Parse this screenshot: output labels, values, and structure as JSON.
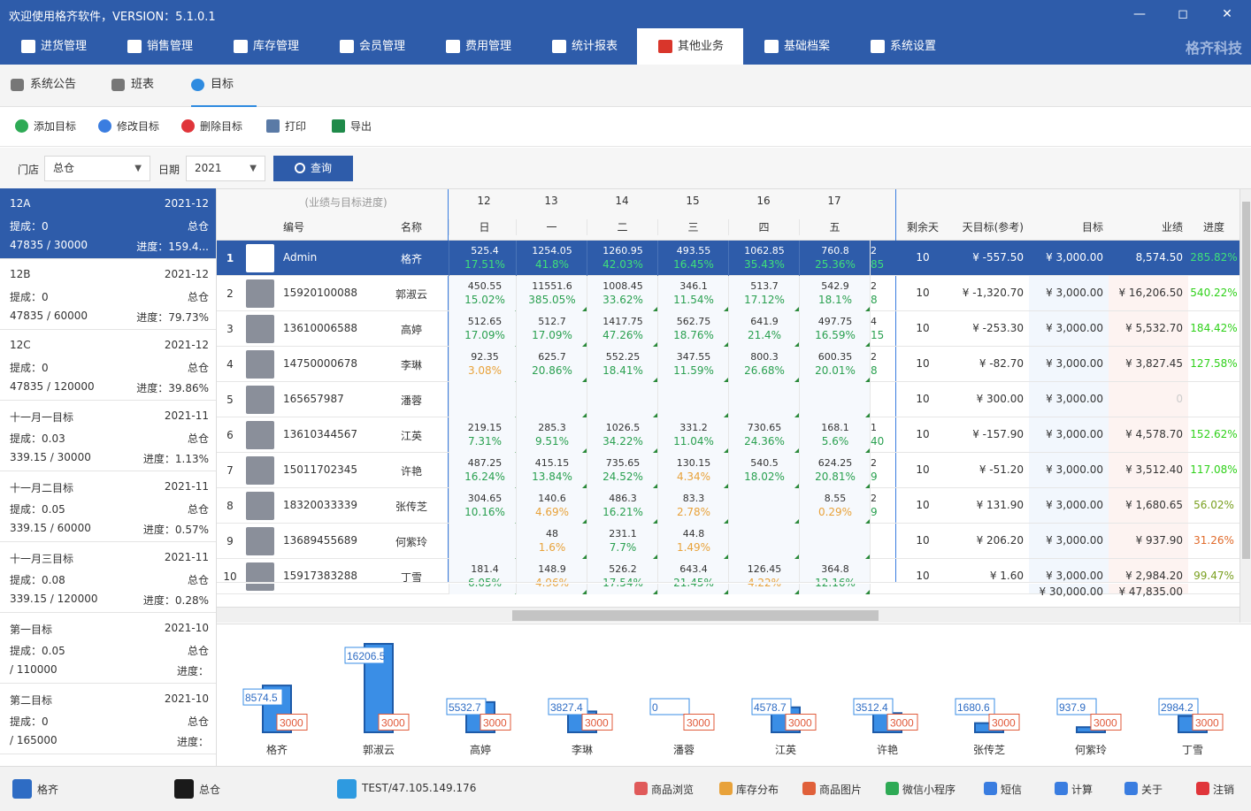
{
  "window": {
    "title": "欢迎使用格齐软件，VERSION：5.1.0.1"
  },
  "nav": {
    "items": [
      {
        "label": "进货管理",
        "icon": "cart-icon"
      },
      {
        "label": "销售管理",
        "icon": "sales-icon"
      },
      {
        "label": "库存管理",
        "icon": "box-icon"
      },
      {
        "label": "会员管理",
        "icon": "crown-icon"
      },
      {
        "label": "费用管理",
        "icon": "wallet-icon"
      },
      {
        "label": "统计报表",
        "icon": "piechart-icon"
      },
      {
        "label": "其他业务",
        "icon": "clover-icon",
        "active": true
      },
      {
        "label": "基础档案",
        "icon": "puzzle-icon"
      },
      {
        "label": "系统设置",
        "icon": "gear-icon"
      }
    ],
    "brand": "格齐科技"
  },
  "subtabs": [
    {
      "label": "系统公告",
      "icon": "megaphone-icon"
    },
    {
      "label": "班表",
      "icon": "calendar-icon"
    },
    {
      "label": "目标",
      "icon": "target-icon",
      "active": true
    }
  ],
  "toolbar": [
    {
      "label": "添加目标",
      "icon": "plus-circle-icon",
      "color": "#2eaa55"
    },
    {
      "label": "修改目标",
      "icon": "edit-icon",
      "color": "#3a7de0"
    },
    {
      "label": "删除目标",
      "icon": "delete-icon",
      "color": "#e0353a"
    },
    {
      "label": "打印",
      "icon": "printer-icon",
      "color": "#5a7aa6"
    },
    {
      "label": "导出",
      "icon": "excel-icon",
      "color": "#1f8a4a"
    }
  ],
  "filter": {
    "store_label": "门店",
    "store_value": "总仓",
    "date_label": "日期",
    "date_value": "2021",
    "query": "查询"
  },
  "targets": [
    {
      "name": "12A",
      "period": "2021-12",
      "bonus": "提成：0",
      "store": "总仓",
      "ratio": "47835 / 30000",
      "progress": "进度：159.4..."
    },
    {
      "name": "12B",
      "period": "2021-12",
      "bonus": "提成：0",
      "store": "总仓",
      "ratio": "47835 / 60000",
      "progress": "进度：79.73%"
    },
    {
      "name": "12C",
      "period": "2021-12",
      "bonus": "提成：0",
      "store": "总仓",
      "ratio": "47835 / 120000",
      "progress": "进度：39.86%"
    },
    {
      "name": "十一月一目标",
      "period": "2021-11",
      "bonus": "提成：0.03",
      "store": "总仓",
      "ratio": "339.15 / 30000",
      "progress": "进度：1.13%"
    },
    {
      "name": "十一月二目标",
      "period": "2021-11",
      "bonus": "提成：0.05",
      "store": "总仓",
      "ratio": "339.15 / 60000",
      "progress": "进度：0.57%"
    },
    {
      "name": "十一月三目标",
      "period": "2021-11",
      "bonus": "提成：0.08",
      "store": "总仓",
      "ratio": "339.15 / 120000",
      "progress": "进度：0.28%"
    },
    {
      "name": "第一目标",
      "period": "2021-10",
      "bonus": "提成：0.05",
      "store": "总仓",
      "ratio": " / 110000",
      "progress": "进度："
    },
    {
      "name": "第二目标",
      "period": "2021-10",
      "bonus": "提成：0",
      "store": "总仓",
      "ratio": " / 165000",
      "progress": "进度："
    }
  ],
  "grid": {
    "group_header": "(业绩与目标进度)",
    "col_id": "编号",
    "col_name": "名称",
    "days": [
      {
        "day": "12",
        "weekday": "日"
      },
      {
        "day": "13",
        "weekday": "一"
      },
      {
        "day": "14",
        "weekday": "二"
      },
      {
        "day": "15",
        "weekday": "三"
      },
      {
        "day": "16",
        "weekday": "四"
      },
      {
        "day": "17",
        "weekday": "五"
      }
    ],
    "col_remaining": "剩余天",
    "col_daily": "天目标(参考)",
    "col_target": "目标",
    "col_sales": "业绩",
    "col_progress": "进度",
    "rows": [
      {
        "no": "1",
        "id": "Admin",
        "name": "格齐",
        "cells": [
          [
            "525.4",
            "17.51%"
          ],
          [
            "1254.05",
            "41.8%"
          ],
          [
            "1260.95",
            "42.03%"
          ],
          [
            "493.55",
            "16.45%"
          ],
          [
            "1062.85",
            "35.43%"
          ],
          [
            "760.8",
            "25.36%"
          ]
        ],
        "edge": [
          "2",
          "85"
        ],
        "remain": "10",
        "daily": "¥ -557.50",
        "target": "¥ 3,000.00",
        "sales": "8,574.50",
        "progress": "285.82%"
      },
      {
        "no": "2",
        "id": "15920100088",
        "name": "郭淑云",
        "cells": [
          [
            "450.55",
            "15.02%"
          ],
          [
            "11551.6",
            "385.05%"
          ],
          [
            "1008.45",
            "33.62%"
          ],
          [
            "346.1",
            "11.54%"
          ],
          [
            "513.7",
            "17.12%"
          ],
          [
            "542.9",
            "18.1%"
          ]
        ],
        "edge": [
          "2",
          "8"
        ],
        "remain": "10",
        "daily": "¥ -1,320.70",
        "target": "¥ 3,000.00",
        "sales": "¥ 16,206.50",
        "progress": "540.22%"
      },
      {
        "no": "3",
        "id": "13610006588",
        "name": "高婷",
        "cells": [
          [
            "512.65",
            "17.09%"
          ],
          [
            "512.7",
            "17.09%"
          ],
          [
            "1417.75",
            "47.26%"
          ],
          [
            "562.75",
            "18.76%"
          ],
          [
            "641.9",
            "21.4%"
          ],
          [
            "497.75",
            "16.59%"
          ]
        ],
        "edge": [
          "4",
          "15"
        ],
        "remain": "10",
        "daily": "¥ -253.30",
        "target": "¥ 3,000.00",
        "sales": "¥ 5,532.70",
        "progress": "184.42%"
      },
      {
        "no": "4",
        "id": "14750000678",
        "name": "李琳",
        "cells": [
          [
            "92.35",
            "3.08%"
          ],
          [
            "625.7",
            "20.86%"
          ],
          [
            "552.25",
            "18.41%"
          ],
          [
            "347.55",
            "11.59%"
          ],
          [
            "800.3",
            "26.68%"
          ],
          [
            "600.35",
            "20.01%"
          ]
        ],
        "edge": [
          "2",
          "8"
        ],
        "remain": "10",
        "daily": "¥ -82.70",
        "target": "¥ 3,000.00",
        "sales": "¥ 3,827.45",
        "progress": "127.58%"
      },
      {
        "no": "5",
        "id": "165657987",
        "name": "潘蓉",
        "cells": [
          [
            "",
            ""
          ],
          [
            "",
            ""
          ],
          [
            "",
            ""
          ],
          [
            "",
            ""
          ],
          [
            "",
            ""
          ],
          [
            "",
            ""
          ]
        ],
        "edge": [
          "",
          ""
        ],
        "remain": "10",
        "daily": "¥ 300.00",
        "target": "¥ 3,000.00",
        "sales": "0",
        "progress": ""
      },
      {
        "no": "6",
        "id": "13610344567",
        "name": "江英",
        "cells": [
          [
            "219.15",
            "7.31%"
          ],
          [
            "285.3",
            "9.51%"
          ],
          [
            "1026.5",
            "34.22%"
          ],
          [
            "331.2",
            "11.04%"
          ],
          [
            "730.65",
            "24.36%"
          ],
          [
            "168.1",
            "5.6%"
          ]
        ],
        "edge": [
          "1",
          "40"
        ],
        "remain": "10",
        "daily": "¥ -157.90",
        "target": "¥ 3,000.00",
        "sales": "¥ 4,578.70",
        "progress": "152.62%"
      },
      {
        "no": "7",
        "id": "15011702345",
        "name": "许艳",
        "cells": [
          [
            "487.25",
            "16.24%"
          ],
          [
            "415.15",
            "13.84%"
          ],
          [
            "735.65",
            "24.52%"
          ],
          [
            "130.15",
            "4.34%"
          ],
          [
            "540.5",
            "18.02%"
          ],
          [
            "624.25",
            "20.81%"
          ]
        ],
        "edge": [
          "2",
          "9"
        ],
        "remain": "10",
        "daily": "¥ -51.20",
        "target": "¥ 3,000.00",
        "sales": "¥ 3,512.40",
        "progress": "117.08%"
      },
      {
        "no": "8",
        "id": "18320033339",
        "name": "张传芝",
        "cells": [
          [
            "304.65",
            "10.16%"
          ],
          [
            "140.6",
            "4.69%"
          ],
          [
            "486.3",
            "16.21%"
          ],
          [
            "83.3",
            "2.78%"
          ],
          [
            "",
            ""
          ],
          [
            "8.55",
            "0.29%"
          ]
        ],
        "edge": [
          "2",
          "9"
        ],
        "remain": "10",
        "daily": "¥ 131.90",
        "target": "¥ 3,000.00",
        "sales": "¥ 1,680.65",
        "progress": "56.02%"
      },
      {
        "no": "9",
        "id": "13689455689",
        "name": "何紫玲",
        "cells": [
          [
            "",
            ""
          ],
          [
            "48",
            "1.6%"
          ],
          [
            "231.1",
            "7.7%"
          ],
          [
            "44.8",
            "1.49%"
          ],
          [
            "",
            ""
          ],
          [
            "",
            ""
          ]
        ],
        "edge": [
          "",
          ""
        ],
        "remain": "10",
        "daily": "¥ 206.20",
        "target": "¥ 3,000.00",
        "sales": "¥ 937.90",
        "progress": "31.26%"
      },
      {
        "no": "10",
        "id": "15917383288",
        "name": "丁雪",
        "cells": [
          [
            "181.4",
            "6.05%"
          ],
          [
            "148.9",
            "4.96%"
          ],
          [
            "526.2",
            "17.54%"
          ],
          [
            "643.4",
            "21.45%"
          ],
          [
            "126.45",
            "4.22%"
          ],
          [
            "364.8",
            "12.16%"
          ]
        ],
        "edge": [
          "",
          ""
        ],
        "remain": "10",
        "daily": "¥ 1.60",
        "target": "¥ 3,000.00",
        "sales": "¥ 2,984.20",
        "progress": "99.47%"
      }
    ],
    "total_target": "¥ 30,000.00",
    "total_sales": "¥ 47,835.00"
  },
  "chart_data": {
    "type": "bar",
    "categories": [
      "格齐",
      "郭淑云",
      "高婷",
      "李琳",
      "潘蓉",
      "江英",
      "许艳",
      "张传芝",
      "何紫玲",
      "丁雪"
    ],
    "series": [
      {
        "values": [
          8574.5,
          16206.5,
          5532.7,
          3827.45,
          0,
          4578.7,
          3512.4,
          1680.65,
          937.9,
          2984.2
        ]
      },
      {
        "values": [
          3000,
          3000,
          3000,
          3000,
          3000,
          3000,
          3000,
          3000,
          3000,
          3000
        ]
      }
    ],
    "value_labels": [
      "8574.5",
      "16206.5",
      "5532.7",
      "3827.4",
      "0",
      "4578.7",
      "3512.4",
      "1680.6",
      "937.9",
      "2984.2"
    ],
    "target_label": "3000",
    "colors": {
      "sales": "#3a8ee6",
      "target": "#e05a3a"
    }
  },
  "status": {
    "user": "格齐",
    "store": "总仓",
    "server": "TEST/47.105.149.176",
    "links": [
      {
        "label": "商品浏览",
        "icon": "tshirt-icon",
        "color": "#e05a5a"
      },
      {
        "label": "库存分布",
        "icon": "dots-icon",
        "color": "#e8a23a"
      },
      {
        "label": "商品图片",
        "icon": "flower-icon",
        "color": "#e0603a"
      },
      {
        "label": "微信小程序",
        "icon": "wechat-icon",
        "color": "#2eaa55"
      },
      {
        "label": "短信",
        "icon": "mail-icon",
        "color": "#3a7de0"
      },
      {
        "label": "计算",
        "icon": "calculator-icon",
        "color": "#3a7de0"
      },
      {
        "label": "关于",
        "icon": "info-icon",
        "color": "#3a7de0"
      },
      {
        "label": "注销",
        "icon": "power-icon",
        "color": "#e0353a"
      }
    ]
  }
}
